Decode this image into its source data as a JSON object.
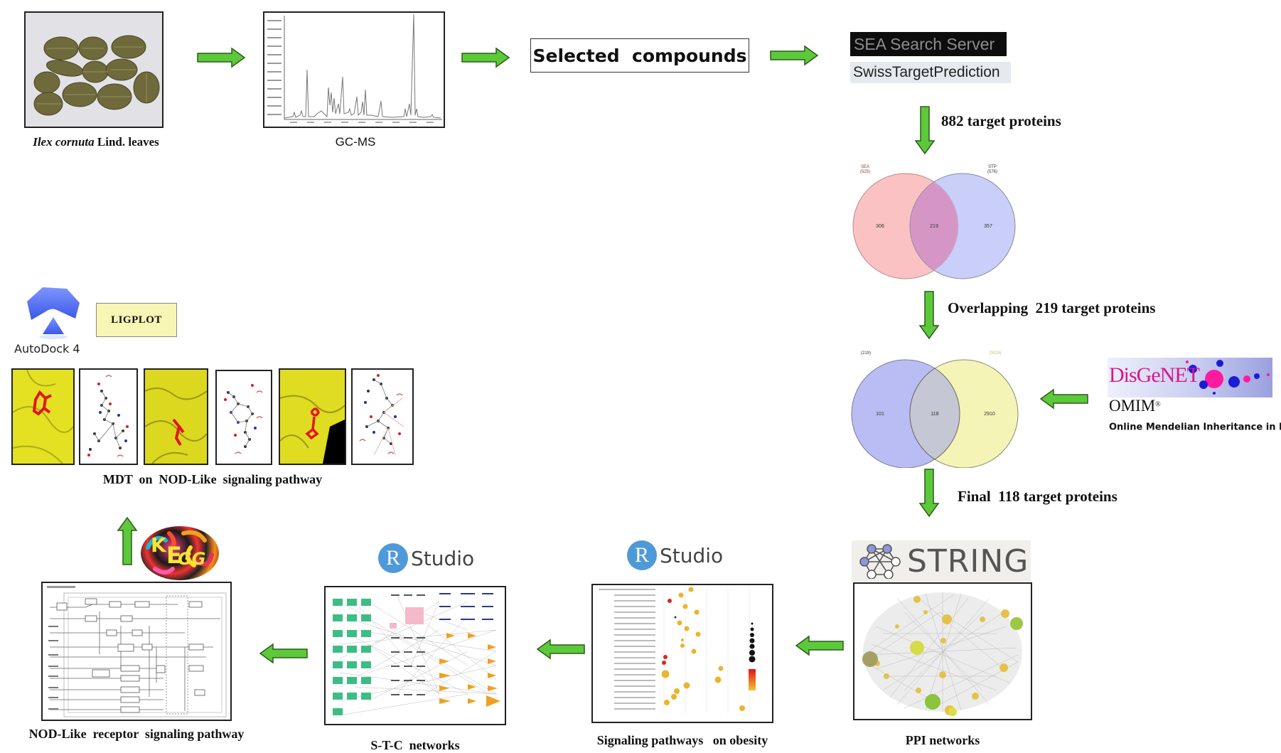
{
  "colors": {
    "arrow_fill": "#5cc93a",
    "arrow_stroke": "#2d5a1b",
    "sea_circle": "#f9b7b7",
    "stp_circle": "#bcc3f7",
    "venn2_left": "#b9bdf3",
    "venn2_right": "#f3f4b6",
    "surface_yellow": "#e8e82a",
    "ligand_red": "#e3161b"
  },
  "plant": {
    "caption_italic": "Ilex cornuta",
    "caption_rest": " Lind.  leaves"
  },
  "gcms": {
    "caption": "GC-MS"
  },
  "selected": {
    "label": "Selected  compounds"
  },
  "databases": {
    "sea": "SEA Search Server",
    "stp": "SwissTargetPrediction"
  },
  "steps": {
    "step1": "882 target proteins",
    "step2": "Overlapping  219 target proteins",
    "step3": "Final  118 target proteins"
  },
  "venn1": {
    "left_label": "SEA",
    "left_total": "(525)",
    "right_label": "STP",
    "right_total": "(576)",
    "left_only": "306",
    "overlap": "219",
    "right_only": "357"
  },
  "venn2": {
    "left_total": "(219)",
    "right_total": "(3028)",
    "left_only": "101",
    "overlap": "118",
    "right_only": "2910"
  },
  "disease_db": {
    "disgenet": "DisGeNET",
    "omim": "OMIM",
    "omim_reg": "®",
    "omim_full": "Online Mendelian Inheritance in Man",
    "omim_full_reg": "®"
  },
  "string": {
    "logo": "STRING",
    "caption": "PPI networks"
  },
  "rstudio1": {
    "r": "R",
    "name": "Studio",
    "caption": "Signaling pathways   on obesity"
  },
  "rstudio2": {
    "r": "R",
    "name": "Studio",
    "caption": "S-T-C  networks"
  },
  "kegg": {
    "logo_k": "K",
    "logo_e": "E",
    "logo_gg": "GG",
    "caption": "NOD-Like  receptor  signaling pathway"
  },
  "docking": {
    "autodock": "AutoDock 4",
    "ligplot": "LIGPLOT",
    "caption": "MDT  on  NOD-Like  signaling pathway"
  }
}
